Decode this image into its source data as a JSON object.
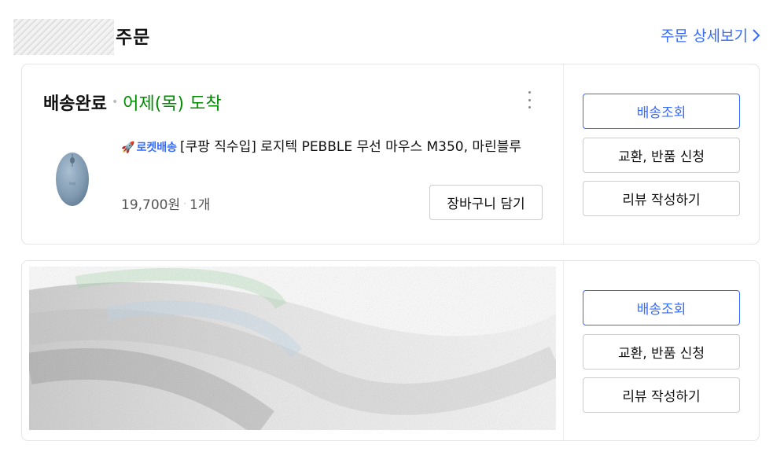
{
  "header": {
    "order_word": "주문",
    "detail_link": "주문 상세보기"
  },
  "orders": [
    {
      "status_done": "배송완료",
      "status_arrival": "어제(목) 도착",
      "badge": "로켓배송",
      "product_title": "[쿠팡 직수입] 로지텍 PEBBLE 무선 마우스 M350, 마린블루",
      "price": "19,700원",
      "quantity": "1개",
      "cart_label": "장바구니 담기",
      "actions": [
        "배송조회",
        "교환, 반품 신청",
        "리뷰 작성하기"
      ]
    },
    {
      "actions": [
        "배송조회",
        "교환, 반품 신청",
        "리뷰 작성하기"
      ]
    }
  ],
  "colors": {
    "accent": "#346aff",
    "arrival_green": "#008c00",
    "border": "#e4e4e4",
    "product": "#8aa3b8"
  },
  "icons": {
    "detail": "chevron-right-icon",
    "more": "more-vertical-icon",
    "badge": "rocket-icon"
  }
}
